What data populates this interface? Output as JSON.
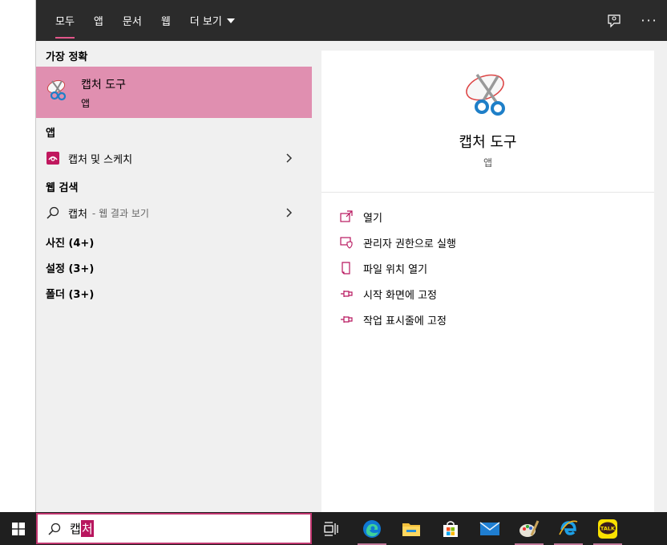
{
  "filter_tabs": [
    {
      "label": "모두",
      "active": true
    },
    {
      "label": "앱"
    },
    {
      "label": "문서"
    },
    {
      "label": "웹"
    },
    {
      "label": "더 보기"
    }
  ],
  "topbar_icons": [
    "feedback-icon",
    "more-options-icon"
  ],
  "more_label": "···",
  "results": {
    "best_match_title": "가장 정확",
    "best_match": {
      "name": "캡처 도구",
      "type": "앱",
      "icon": "snipping-tool-icon"
    },
    "apps_title": "앱",
    "apps": [
      {
        "label": "캡처 및 스케치",
        "icon": "snip-sketch-icon"
      }
    ],
    "web_title": "웹 검색",
    "web": [
      {
        "label": "캡처",
        "sub": "- 웹 결과 보기",
        "icon": "search-icon"
      }
    ],
    "more_sections": [
      {
        "label": "사진 (4+)"
      },
      {
        "label": "설정 (3+)"
      },
      {
        "label": "폴더 (3+)"
      }
    ]
  },
  "preview": {
    "name": "캡처 도구",
    "type": "앱",
    "actions": [
      {
        "label": "열기",
        "icon": "open-icon"
      },
      {
        "label": "관리자 권한으로 실행",
        "icon": "shield-icon"
      },
      {
        "label": "파일 위치 열기",
        "icon": "file-location-icon"
      },
      {
        "label": "시작 화면에 고정",
        "icon": "pin-icon"
      },
      {
        "label": "작업 표시줄에 고정",
        "icon": "pin-icon"
      }
    ]
  },
  "taskbar": {
    "search_text_plain": "캡",
    "search_text_selected": "처",
    "apps": [
      "task-view-icon",
      "edge-icon",
      "file-explorer-icon",
      "store-icon",
      "mail-icon",
      "paint-icon",
      "ie-icon",
      "kakaotalk-icon"
    ],
    "kakaotalk_label": "TALK"
  },
  "colors": {
    "accent": "#e08fb0",
    "accent_dark": "#b8165e",
    "topbar_bg": "#2b2b2b",
    "taskbar_bg": "#1f1f1f",
    "panel_bg": "#f0f0f0"
  }
}
